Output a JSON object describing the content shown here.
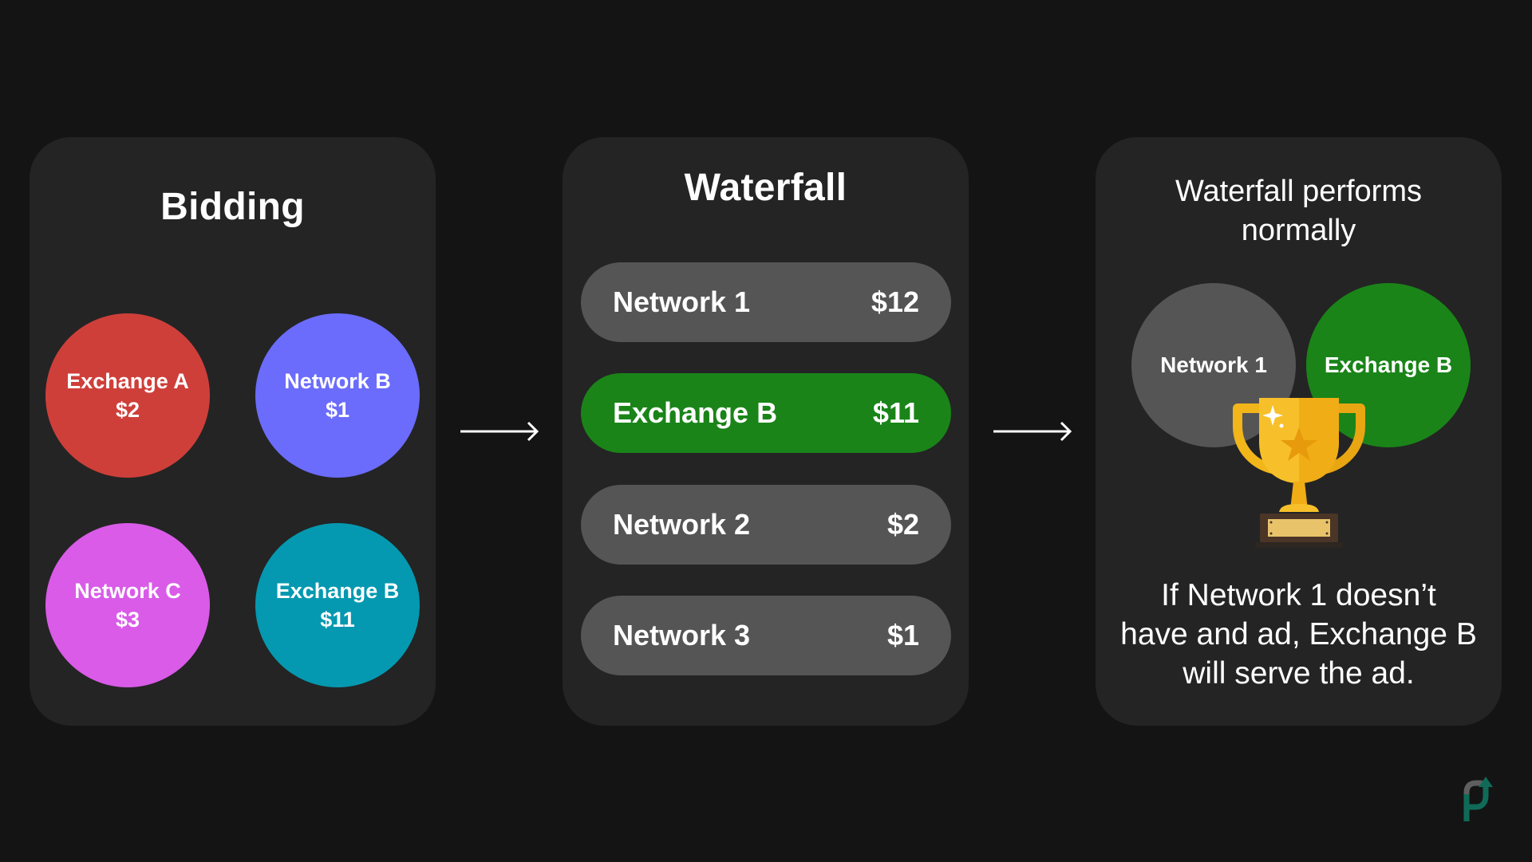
{
  "bidding": {
    "title": "Bidding",
    "bidders": [
      {
        "name": "Exchange A",
        "price": "$2",
        "color": "#cf3f3a"
      },
      {
        "name": "Network B",
        "price": "$1",
        "color": "#6b6cfb"
      },
      {
        "name": "Network C",
        "price": "$3",
        "color": "#d95be8"
      },
      {
        "name": "Exchange B",
        "price": "$11",
        "color": "#0499b0"
      }
    ]
  },
  "waterfall": {
    "title": "Waterfall",
    "rows": [
      {
        "name": "Network 1",
        "price": "$12",
        "highlight": false
      },
      {
        "name": "Exchange B",
        "price": "$11",
        "highlight": true
      },
      {
        "name": "Network 2",
        "price": "$2",
        "highlight": false
      },
      {
        "name": "Network 3",
        "price": "$1",
        "highlight": false
      }
    ],
    "highlight_color": "#1a8418",
    "row_color": "#555555"
  },
  "result": {
    "title_line1": "Waterfall performs",
    "title_line2": "normally",
    "circles": [
      {
        "name": "Network 1",
        "color": "#555555"
      },
      {
        "name": "Exchange B",
        "color": "#1a8418"
      }
    ],
    "icon": "trophy-icon",
    "body_line1": "If Network 1 doesn’t",
    "body_line2": "have and ad, Exchange B",
    "body_line3": "will serve the ad."
  },
  "arrows": [
    "arrow-right-icon",
    "arrow-right-icon"
  ],
  "logo": {
    "icon": "brand-logo-icon",
    "colors": [
      "#6a6a6a",
      "#0f6b57"
    ]
  }
}
